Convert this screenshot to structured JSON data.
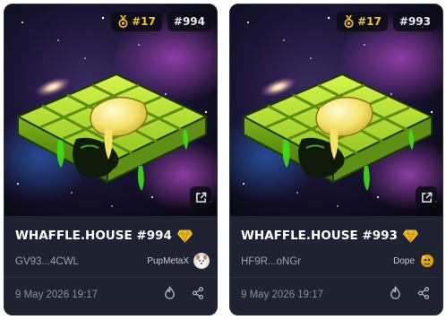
{
  "cards": [
    {
      "rank": "#17",
      "number": "#994",
      "title": "WHAFFLE.HOUSE #994",
      "address": "GV93...4CWL",
      "owner": "PupMetaX",
      "date": "9 May 2026 19:17",
      "avatar_style": "white-pup"
    },
    {
      "rank": "#17",
      "number": "#993",
      "title": "WHAFFLE.HOUSE #993",
      "address": "HF9R...oNGr",
      "owner": "Dope",
      "date": "9 May 2026 19:17",
      "avatar_style": "gold-dope"
    }
  ],
  "colors": {
    "card_bg": "#1f2230",
    "rank_gold": "#f5c518",
    "waffle_green": "#9acd32",
    "slime_green": "#39ff14",
    "butter": "#f4e26a",
    "diamond_gold": "#f2b705"
  },
  "icons": {
    "rank": "medal-icon",
    "external": "external-link-icon",
    "verified": "diamond-icon",
    "fire": "fire-icon",
    "share": "share-icon"
  }
}
